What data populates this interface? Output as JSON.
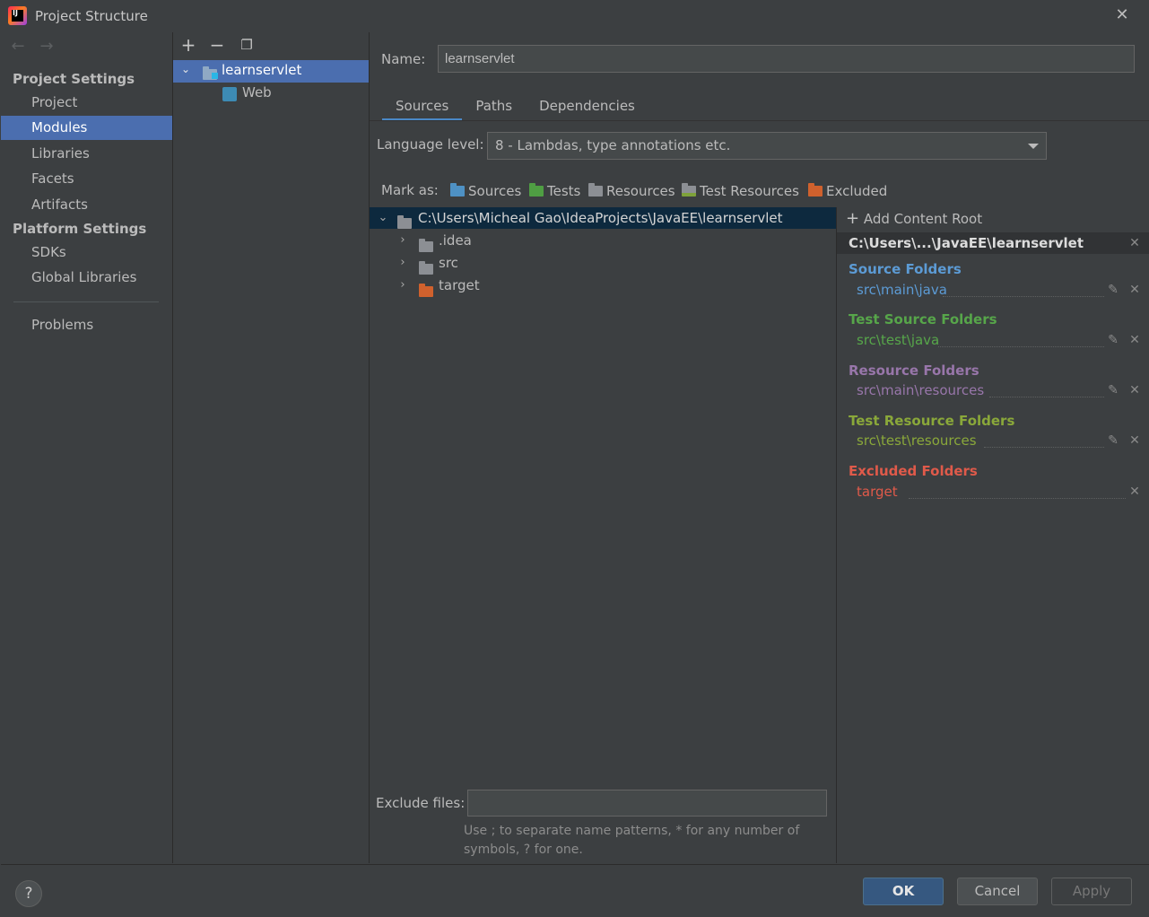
{
  "window": {
    "title": "Project Structure"
  },
  "colors": {
    "selection": "#4b6eaf",
    "source": "#5c9bd5",
    "test": "#57a64a",
    "resource": "#9876aa",
    "test_resource": "#8aa83a",
    "excluded": "#e05a4a",
    "excluded_folder": "#d0612d"
  },
  "nav": {
    "project_settings": "Project Settings",
    "project_items": [
      "Project",
      "Modules",
      "Libraries",
      "Facets",
      "Artifacts"
    ],
    "platform_settings": "Platform Settings",
    "platform_items": [
      "SDKs",
      "Global Libraries"
    ],
    "problems": "Problems"
  },
  "modules": {
    "module_name": "learnservlet",
    "facet": "Web"
  },
  "editor": {
    "name_label": "Name:",
    "name_value": "learnservlet",
    "tabs": [
      "Sources",
      "Paths",
      "Dependencies"
    ],
    "language_level_label": "Language level:",
    "language_level_value": "8 - Lambdas, type annotations etc.",
    "mark_as_label": "Mark as:",
    "mark_as": [
      "Sources",
      "Tests",
      "Resources",
      "Test Resources",
      "Excluded"
    ]
  },
  "tree": {
    "root": "C:\\Users\\Micheal Gao\\IdeaProjects\\JavaEE\\learnservlet",
    "children": [
      ".idea",
      "src",
      "target"
    ]
  },
  "roots": {
    "add_content_root": "Add Content Root",
    "root_path": "C:\\Users\\...\\JavaEE\\learnservlet",
    "source_title": "Source Folders",
    "source_path": "src\\main\\java",
    "test_title": "Test Source Folders",
    "test_path": "src\\test\\java",
    "resource_title": "Resource Folders",
    "resource_path": "src\\main\\resources",
    "test_resource_title": "Test Resource Folders",
    "test_resource_path": "src\\test\\resources",
    "excluded_title": "Excluded Folders",
    "excluded_path": "target"
  },
  "exclude": {
    "label": "Exclude files:",
    "value": "",
    "hint_line1": "Use ; to separate name patterns, * for any number of",
    "hint_line2": "symbols, ? for one."
  },
  "buttons": {
    "ok": "OK",
    "cancel": "Cancel",
    "apply": "Apply",
    "help": "?"
  }
}
